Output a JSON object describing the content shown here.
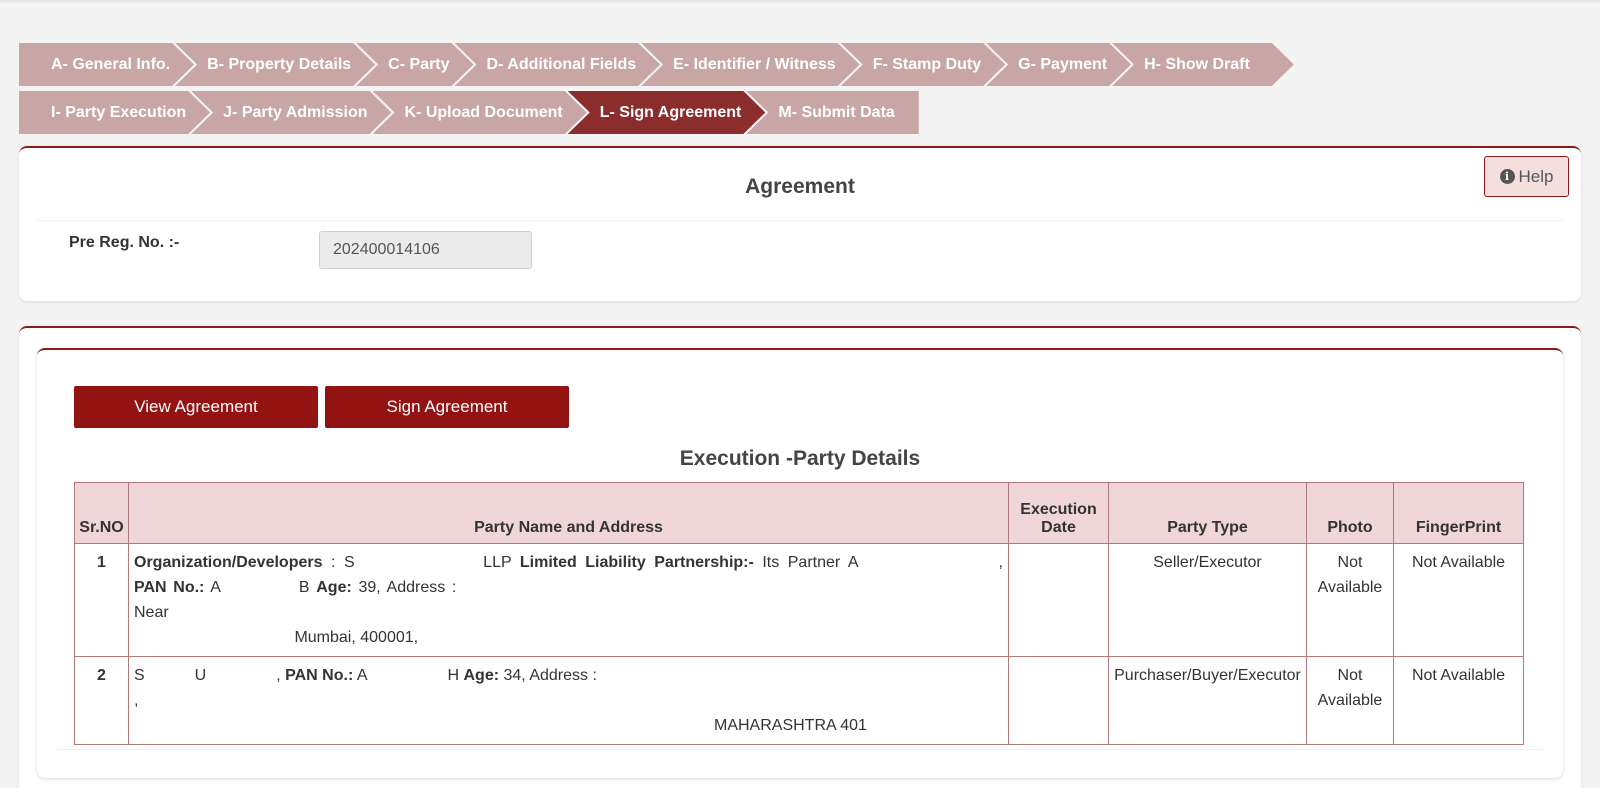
{
  "steps_row1": [
    {
      "label": "A- General Info."
    },
    {
      "label": "B- Property Details"
    },
    {
      "label": "C- Party"
    },
    {
      "label": "D- Additional Fields"
    },
    {
      "label": "E- Identifier / Witness"
    },
    {
      "label": "F- Stamp Duty"
    },
    {
      "label": "G- Payment"
    },
    {
      "label": "H- Show Draft"
    }
  ],
  "steps_row2": [
    {
      "label": "I- Party Execution"
    },
    {
      "label": "J- Party Admission"
    },
    {
      "label": "K- Upload Document"
    },
    {
      "label": "L- Sign Agreement",
      "active": true
    },
    {
      "label": "M- Submit Data"
    }
  ],
  "colors": {
    "step_bg": "#c9a6a6",
    "step_active": "#8c2d2d",
    "button_red": "#931313",
    "table_header_bg": "#f0d6d9"
  },
  "agreement": {
    "help_label": "Help",
    "help_icon": "info-circle-icon",
    "title": "Agreement",
    "pre_reg_label": "Pre Reg. No. :-",
    "pre_reg_value": "202400014106"
  },
  "actions": {
    "view_label": "View Agreement",
    "sign_label": "Sign Agreement"
  },
  "execution": {
    "title": "Execution -Party Details",
    "columns": [
      "Sr.NO",
      "Party Name and Address",
      "Execution Date",
      "Party Type",
      "Photo",
      "FingerPrint"
    ],
    "rows": [
      {
        "sr": "1",
        "org_label": "Organization/Developers",
        "name_prefix": " : S",
        "llp_text": " LLP ",
        "llp_label": "Limited Liability Partnership:-",
        "partner_text": " Its Partner A",
        "pan_label": "PAN No.:",
        "pan_prefix": " A",
        "pan_suffix": "B ",
        "age_label": "Age:",
        "age_text": " 39, Address : ",
        "near_text": " Near",
        "address_tail": "Mumbai, 400001,",
        "execution_date": "",
        "party_type": "Seller/Executor",
        "photo": "Not Available",
        "fingerprint": "Not Available"
      },
      {
        "sr": "2",
        "name_prefix": "S",
        "name_mid": "U",
        "pan_label": "PAN No.:",
        "pan_prefix": " A",
        "pan_suffix": "H ",
        "age_label": "Age:",
        "age_text": " 34, Address : ",
        "address_tail": "MAHARASHTRA 401",
        "execution_date": "",
        "party_type": "Purchaser/Buyer/Executor",
        "photo": "Not Available",
        "fingerprint": "Not Available"
      }
    ]
  }
}
